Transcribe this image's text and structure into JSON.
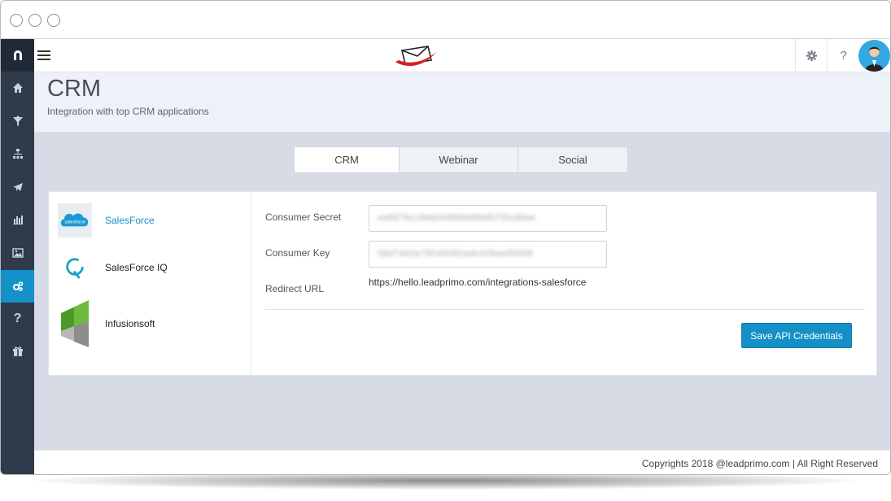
{
  "topbar": {
    "menu_icon": "hamburger-menu-icon",
    "logo": "envelope-logo",
    "settings_icon": "gear-icon",
    "help_label": "?",
    "avatar": "user-avatar"
  },
  "sidebar": {
    "items": [
      {
        "icon": "magnet-logo-icon"
      },
      {
        "icon": "home-icon"
      },
      {
        "icon": "funnel-icon"
      },
      {
        "icon": "sitemap-icon"
      },
      {
        "icon": "paper-plane-icon"
      },
      {
        "icon": "bar-chart-icon"
      },
      {
        "icon": "image-icon"
      },
      {
        "icon": "gears-icon",
        "active": true
      },
      {
        "icon": "question-icon"
      },
      {
        "icon": "gift-icon"
      }
    ]
  },
  "header": {
    "title": "CRM",
    "subtitle": "Integration with top CRM applications"
  },
  "tabs": [
    {
      "label": "CRM",
      "active": true
    },
    {
      "label": "Webinar"
    },
    {
      "label": "Social"
    }
  ],
  "crm_list": [
    {
      "label": "SalesForce",
      "icon": "salesforce-logo",
      "selected": true,
      "logo_text": "salesforce"
    },
    {
      "label": "SalesForce IQ",
      "icon": "salesforce-iq-logo"
    },
    {
      "label": "Infusionsoft",
      "icon": "infusionsoft-logo"
    }
  ],
  "form": {
    "consumer_secret_label": "Consumer Secret",
    "consumer_secret_value": "ee687bcc8e60498bb6f84f075fcd0ee",
    "consumer_key_label": "Consumer Key",
    "consumer_key_value": "58d74d2e76546082adc426ee85068",
    "redirect_label": "Redirect URL",
    "redirect_value": "https://hello.leadprimo.com/integrations-salesforce",
    "save_label": "Save API Credentials"
  },
  "footer": {
    "text": "Copyrights 2018 @leadprimo.com | All Right Reserved"
  },
  "colors": {
    "accent": "#1591c9",
    "sidebar": "#2f3a4b",
    "content_bg": "#d7dbe5"
  }
}
